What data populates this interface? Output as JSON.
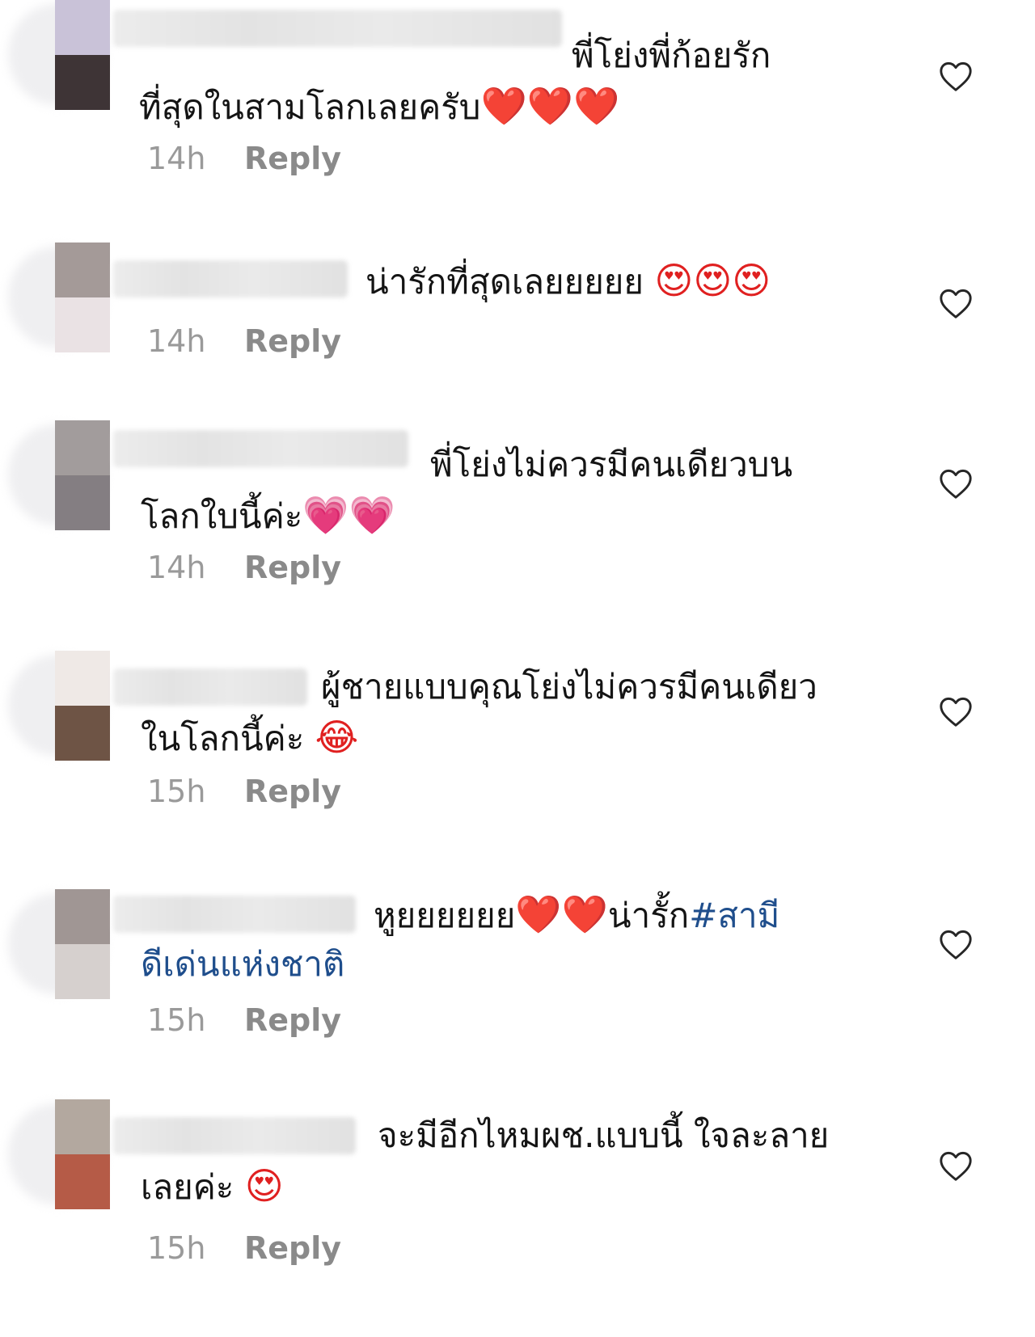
{
  "comments": [
    {
      "lines": [
        "พี่โย่งพี่ก้อยรัก",
        "ที่สุดในสามโลกเลยครับ"
      ],
      "emoji": "❤️❤️❤️",
      "time": "14h",
      "reply": "Reply",
      "avatar_colors": [
        "#c9c2d8",
        "#3e3436"
      ]
    },
    {
      "lines": [
        "น่ารักที่สุดเลยยยยย"
      ],
      "emoji": "😍😍😍",
      "time": "14h",
      "reply": "Reply",
      "avatar_colors": [
        "#a49a98",
        "#eae2e4"
      ]
    },
    {
      "lines": [
        "พี่โย่งไม่ควรมีคนเดียวบน",
        "โลกใบนี้ค่ะ"
      ],
      "emoji": "💗💗",
      "time": "14h",
      "reply": "Reply",
      "avatar_colors": [
        "#a29c9c",
        "#847e82"
      ]
    },
    {
      "lines": [
        "ผู้ชายแบบคุณโย่งไม่ควรมีคนเดียว",
        "ในโลกนี้ค่ะ"
      ],
      "emoji": "😂",
      "time": "15h",
      "reply": "Reply",
      "avatar_colors": [
        "#efe9e6",
        "#6e5445"
      ]
    },
    {
      "lines": [
        "หูยยยยยย",
        "ดีเด่นแห่งชาติ"
      ],
      "line1_emoji": "❤️❤️",
      "line1_after": "น่ารั้ก",
      "hashtag_start": "#สามี",
      "time": "15h",
      "reply": "Reply",
      "avatar_colors": [
        "#a09694",
        "#d6d0ce"
      ]
    },
    {
      "lines": [
        "จะมีอีกไหมผช.แบบนี้ ใจละลาย",
        "เลยค่ะ"
      ],
      "emoji": "😍",
      "time": "15h",
      "reply": "Reply",
      "avatar_colors": [
        "#b3a89f",
        "#b55b47"
      ]
    }
  ]
}
